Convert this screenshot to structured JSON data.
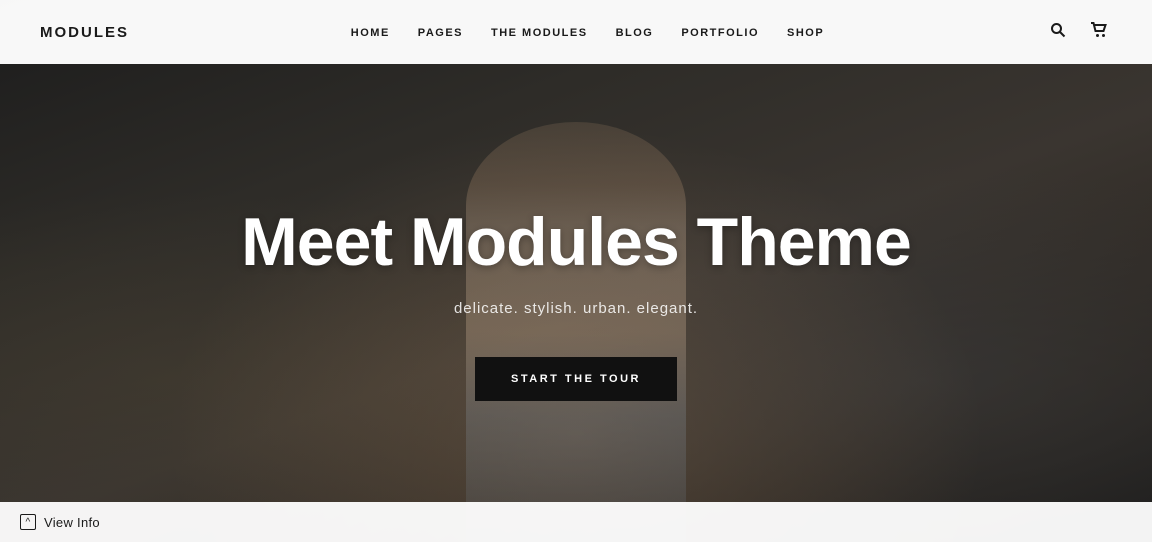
{
  "site": {
    "logo": "MODULES"
  },
  "navbar": {
    "links": [
      {
        "label": "HOME",
        "id": "home"
      },
      {
        "label": "PAGES",
        "id": "pages"
      },
      {
        "label": "THE MODULES",
        "id": "the-modules"
      },
      {
        "label": "BLOG",
        "id": "blog"
      },
      {
        "label": "PORTFOLIO",
        "id": "portfolio"
      },
      {
        "label": "SHOP",
        "id": "shop"
      }
    ],
    "search_icon": "🔍",
    "cart_icon": "🛒"
  },
  "hero": {
    "title": "Meet Modules Theme",
    "subtitle": "delicate. stylish. urban. elegant.",
    "cta_label": "START THE TOUR"
  },
  "footer_bar": {
    "view_info_label": "View Info",
    "chevron": "^"
  }
}
